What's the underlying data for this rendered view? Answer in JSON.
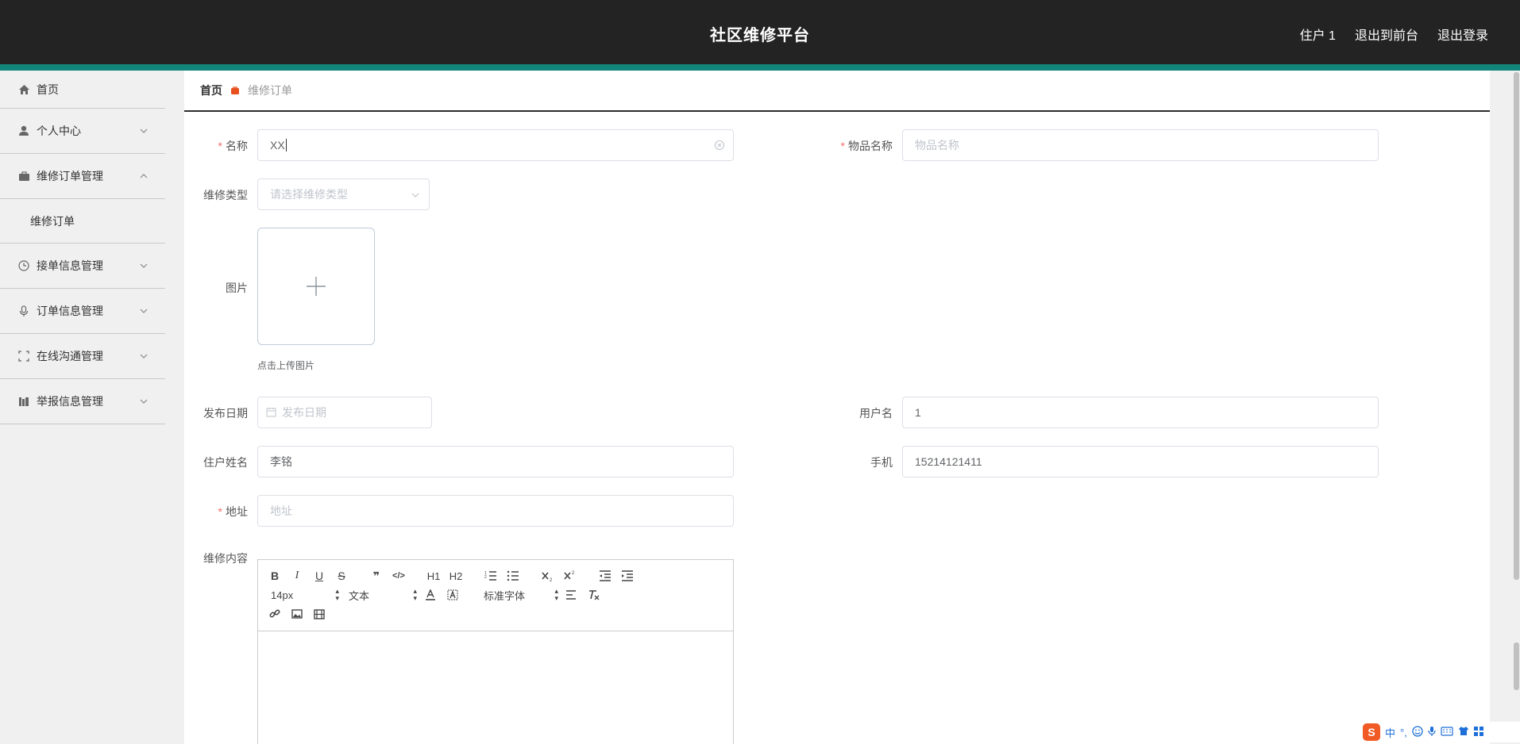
{
  "header": {
    "title": "社区维修平台",
    "user": "住户 1",
    "to_front": "退出到前台",
    "logout": "退出登录"
  },
  "sidebar": {
    "items": [
      {
        "label": "首页",
        "icon": "home-icon"
      },
      {
        "label": "个人中心",
        "icon": "user-icon"
      },
      {
        "label": "维修订单管理",
        "icon": "briefcase-icon",
        "expanded": true,
        "sub": [
          "维修订单"
        ]
      },
      {
        "label": "接单信息管理",
        "icon": "clock-icon"
      },
      {
        "label": "订单信息管理",
        "icon": "microphone-icon"
      },
      {
        "label": "在线沟通管理",
        "icon": "fullscreen-icon"
      },
      {
        "label": "举报信息管理",
        "icon": "books-icon"
      }
    ]
  },
  "breadcrumb": {
    "home": "首页",
    "current": "维修订单"
  },
  "form": {
    "name": {
      "label": "名称",
      "value": "XX"
    },
    "item_name": {
      "label": "物品名称",
      "placeholder": "物品名称"
    },
    "repair_type": {
      "label": "维修类型",
      "placeholder": "请选择维修类型"
    },
    "image": {
      "label": "图片",
      "tip": "点击上传图片"
    },
    "publish_date": {
      "label": "发布日期",
      "placeholder": "发布日期"
    },
    "username": {
      "label": "用户名",
      "value": "1"
    },
    "resident_name": {
      "label": "住户姓名",
      "value": "李铭"
    },
    "phone": {
      "label": "手机",
      "value": "15214121411"
    },
    "address": {
      "label": "地址",
      "placeholder": "地址"
    },
    "content": {
      "label": "维修内容"
    }
  },
  "editor": {
    "font_size": "14px",
    "header_type": "文本",
    "font_family": "标准字体",
    "buttons": [
      "B",
      "I",
      "U",
      "S",
      "❞",
      "</>",
      "H1",
      "H2"
    ]
  },
  "ime": {
    "lang": "中",
    "punct": "°,"
  },
  "colors": {
    "header_bg": "#232323",
    "accent": "#12857a",
    "required": "#f56c6c",
    "breadcrumb_icon": "#e8501f"
  }
}
